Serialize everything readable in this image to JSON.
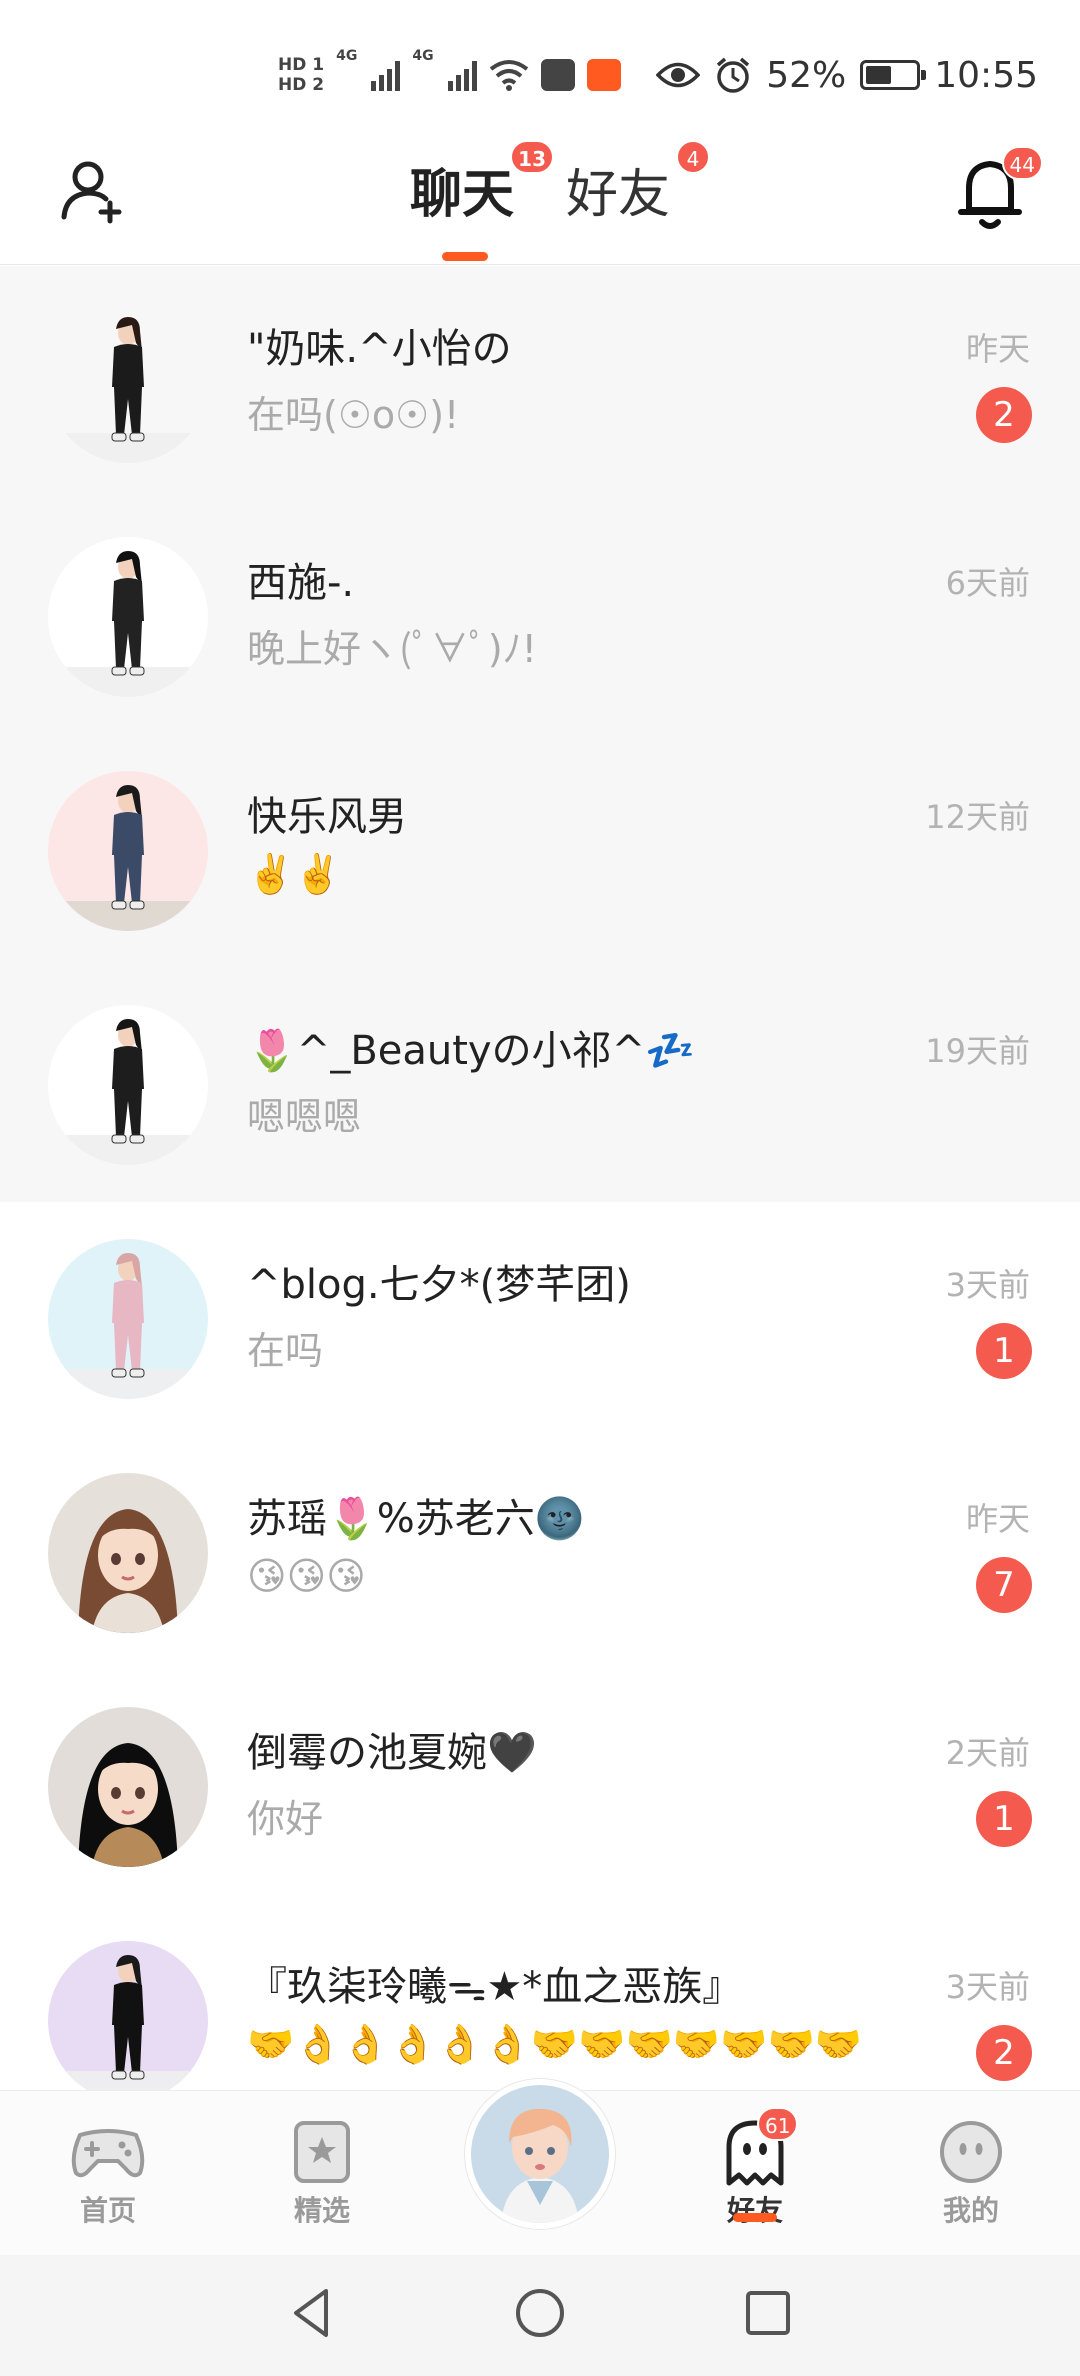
{
  "status_bar": {
    "hd1": "HD 1",
    "hd2": "HD 2",
    "net1": "4G",
    "net2": "4G",
    "battery_percent": "52%",
    "battery_level": 0.52,
    "time": "10:55"
  },
  "header": {
    "tabs": [
      {
        "label": "聊天",
        "badge": "13",
        "active": true
      },
      {
        "label": "好友",
        "badge": "4",
        "active": false
      }
    ],
    "notification_badge": "44"
  },
  "chats": [
    {
      "name": "\"奶味.^小怡の",
      "preview": "在吗(☉o☉)!",
      "time": "昨天",
      "unread": "2",
      "avatar_bg": "#f7f7f7"
    },
    {
      "name": "西施-.",
      "preview": "晚上好ヽ(ﾟ∀ﾟ)ﾉ!",
      "time": "6天前",
      "unread": "",
      "avatar_bg": "#ffffff"
    },
    {
      "name": "快乐风男",
      "preview": "✌️✌️",
      "time": "12天前",
      "unread": "",
      "avatar_bg": "#fce6e6"
    },
    {
      "name": "🌷^_Beautyの小祁^💤",
      "preview": "嗯嗯嗯",
      "time": "19天前",
      "unread": "",
      "avatar_bg": "#ffffff"
    },
    {
      "name": "^blog.七夕*(梦芊团)",
      "preview": "在吗",
      "time": "3天前",
      "unread": "1",
      "avatar_bg": "#dff3f8"
    },
    {
      "name": "苏瑶🌷%苏老六🌚",
      "preview": "😘😘😘",
      "time": "昨天",
      "unread": "7",
      "avatar_bg": "#e5e0da"
    },
    {
      "name": "倒霉の池夏婉🖤",
      "preview": "你好",
      "time": "2天前",
      "unread": "1",
      "avatar_bg": "#e2ddd8"
    },
    {
      "name": "『玖柒玲曦ᯓ★*血之恶族』",
      "preview": "🤝👌👌👌👌👌🤝🤝🤝🤝🤝🤝🤝",
      "time": "3天前",
      "unread": "2",
      "avatar_bg": "#e8dcf5"
    }
  ],
  "bottom_nav": {
    "items": [
      {
        "label": "首页",
        "icon": "gamepad-icon"
      },
      {
        "label": "精选",
        "icon": "star-badge-icon"
      },
      {
        "label": "好友",
        "icon": "ghost-icon",
        "badge": "61",
        "active": true
      },
      {
        "label": "我的",
        "icon": "face-icon"
      }
    ]
  },
  "colors": {
    "accent": "#ff5a1f",
    "badge": "#f45a4e",
    "unread_row_bg": "#f7f7f7"
  }
}
